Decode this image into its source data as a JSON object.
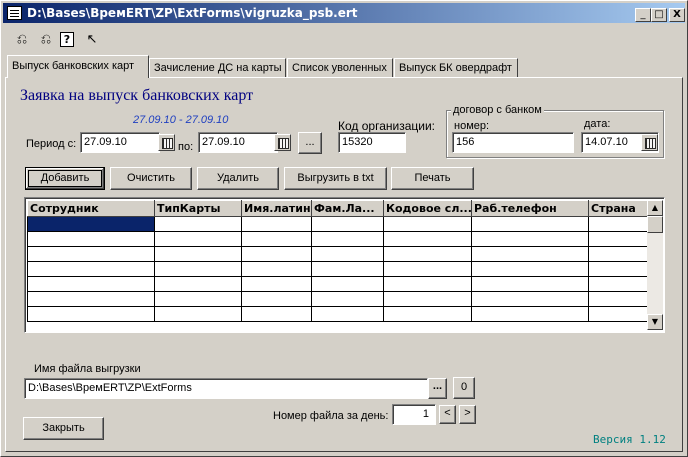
{
  "window": {
    "title": "D:\\Bases\\ВремERT\\ZP\\ExtForms\\vigruzka_psb.ert",
    "controls": [
      "_",
      "□",
      "X"
    ]
  },
  "toolbar": {
    "icons": [
      "open-icon",
      "save-icon",
      "help-icon",
      "whatsthis-icon"
    ],
    "glyphs": [
      "⎌",
      "⎌",
      "?",
      "↖"
    ]
  },
  "tabs": [
    {
      "label": "Выпуск банковских карт",
      "active": true
    },
    {
      "label": "Зачисление ДС на карты",
      "active": false
    },
    {
      "label": "Список уволенных",
      "active": false
    },
    {
      "label": "Выпуск БК овердрафт",
      "active": false
    }
  ],
  "form": {
    "heading": "Заявка на выпуск банковских карт",
    "period_display": "27.09.10 - 27.09.10",
    "period_from_label": "Период с:",
    "period_from": "27.09.10",
    "period_to_label": "по:",
    "period_to": "27.09.10",
    "ellipsis": "...",
    "org_code_label": "Код организации:",
    "org_code": "15320",
    "contract_group_label": "договор с банком",
    "contract_number_label": "номер:",
    "contract_number": "156",
    "contract_date_label": "дата:",
    "contract_date": "14.07.10"
  },
  "actions": {
    "add": "Добавить",
    "clear": "Очистить",
    "delete": "Удалить",
    "export_txt": "Выгрузить в txt",
    "print": "Печать"
  },
  "grid": {
    "columns": [
      "Сотрудник",
      "ТипКарты",
      "Имя.латин",
      "Фам.Ла...",
      "Кодовое сл...",
      "Раб.телефон",
      "Страна"
    ],
    "empty_rows": 7
  },
  "export": {
    "file_label": "Имя файла выгрузки",
    "file_path": "D:\\Bases\\ВремERT\\ZP\\ExtForms",
    "browse": "...",
    "zero": "0",
    "file_number_label": "Номер файла за день:",
    "file_number": "1",
    "prev": "<",
    "next": ">"
  },
  "footer": {
    "close": "Закрыть",
    "version": "Версия 1.12"
  }
}
